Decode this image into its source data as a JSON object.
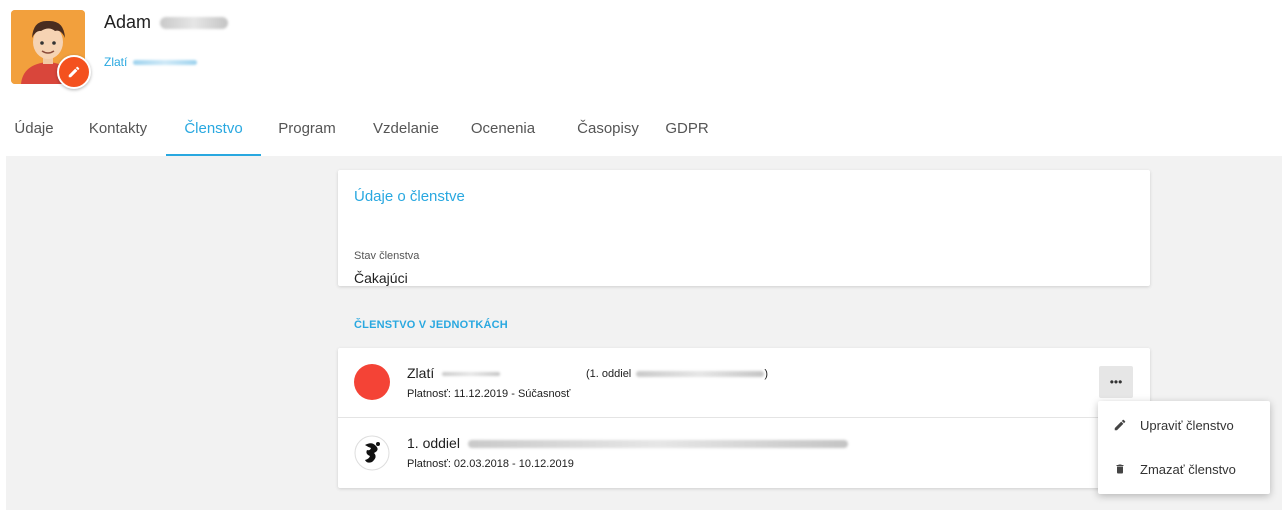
{
  "profile": {
    "name": "Adam",
    "subtitle": "Zlatí"
  },
  "tabs": [
    {
      "label": "Údaje"
    },
    {
      "label": "Kontakty"
    },
    {
      "label": "Členstvo",
      "active": true
    },
    {
      "label": "Program"
    },
    {
      "label": "Vzdelanie"
    },
    {
      "label": "Ocenenia"
    },
    {
      "label": "Časopisy"
    },
    {
      "label": "GDPR"
    }
  ],
  "membership_card": {
    "title": "Údaje o členstve",
    "status_label": "Stav členstva",
    "status_value": "Čakajúci"
  },
  "units_section": {
    "heading": "ČLENSTVO V JEDNOTKÁCH",
    "items": [
      {
        "title": "Zlatí",
        "extra": "(1. oddiel",
        "extra_close": ")",
        "validity": "Platnosť: 11.12.2019 - Súčasnosť",
        "marker_color": "#f44336"
      },
      {
        "title": "1. oddiel",
        "validity": "Platnosť: 02.03.2018 - 10.12.2019"
      }
    ],
    "more_label": "•••"
  },
  "context_menu": {
    "items": [
      {
        "label": "Upraviť členstvo",
        "icon": "pencil-icon"
      },
      {
        "label": "Zmazať členstvo",
        "icon": "trash-icon"
      }
    ]
  },
  "colors": {
    "accent": "#29a8e0",
    "fab": "#f4511e",
    "background": "#f2f2f2"
  }
}
